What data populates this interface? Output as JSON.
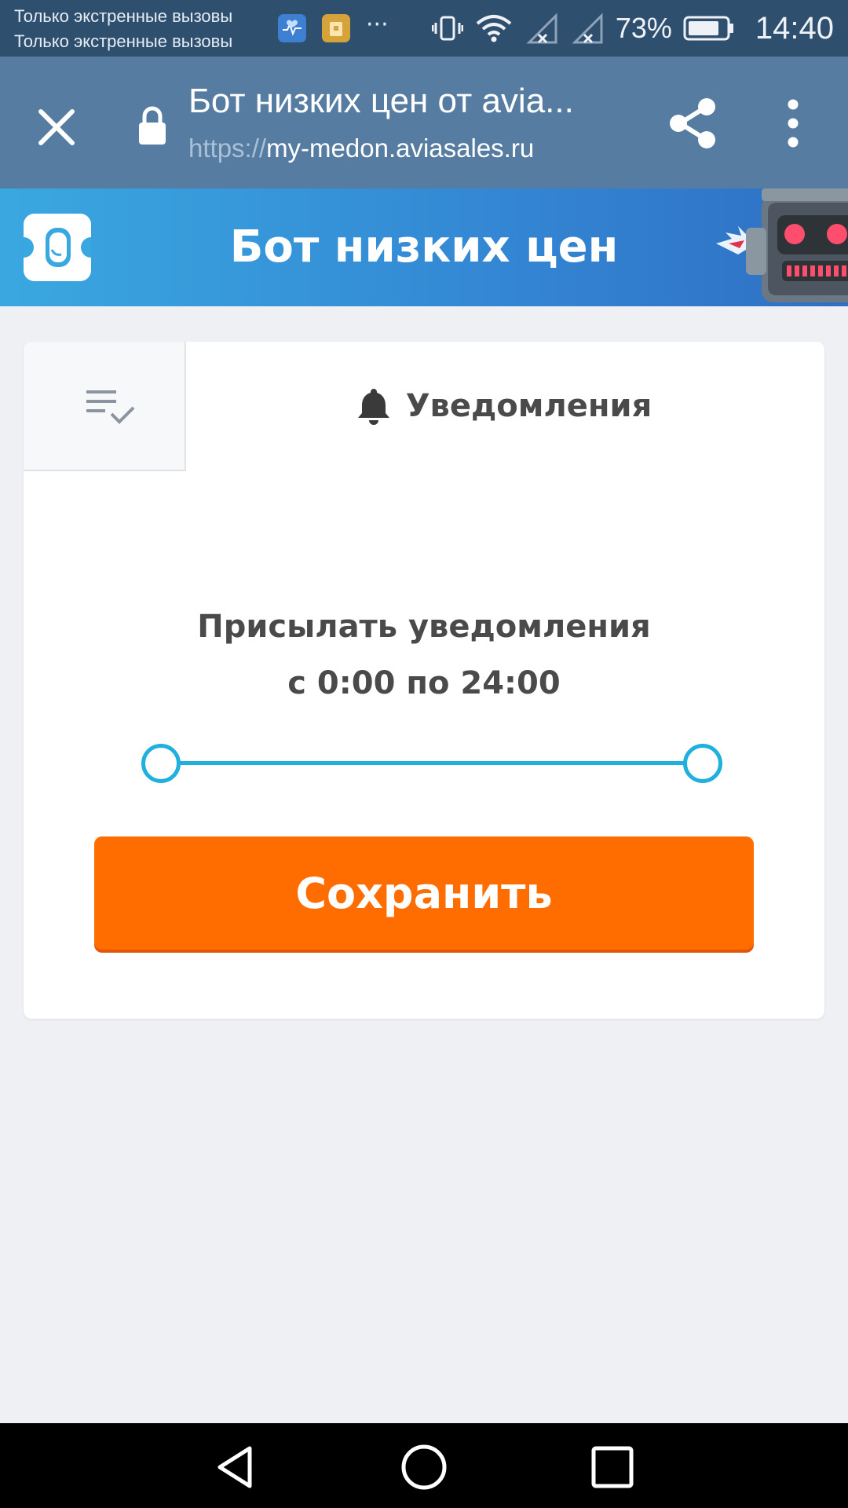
{
  "status_bar": {
    "carrier_line1": "Только экстренные вызовы",
    "carrier_line2": "Только экстренные вызовы",
    "battery_percent": "73%",
    "time": "14:40",
    "icons": [
      "health-app-icon",
      "wallet-app-icon",
      "more-notifications-icon",
      "vibrate-icon",
      "wifi-icon",
      "signal-icon",
      "signal-icon",
      "battery-icon"
    ]
  },
  "browser": {
    "title": "Бот низких цен от avia...",
    "url_scheme": "https://",
    "url_host": "my-medon.aviasales.ru"
  },
  "header": {
    "title": "Бот низких цен"
  },
  "card": {
    "tab_notifications_label": "Уведомления",
    "notify_line1": "Присылать уведомления",
    "notify_line2": "с 0:00 по 24:00",
    "slider": {
      "start": 0,
      "end": 24,
      "min": 0,
      "max": 24
    },
    "save_label": "Сохранить"
  },
  "colors": {
    "accent_orange": "#ff6d00",
    "slider_blue": "#1fb0de",
    "toolbar_blue": "#567da1",
    "status_bar": "#2f4f6e"
  }
}
